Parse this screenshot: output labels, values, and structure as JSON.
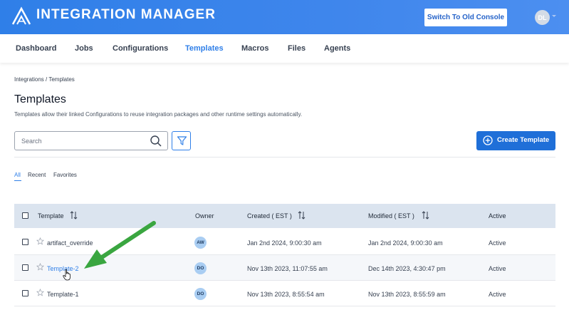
{
  "header": {
    "app_title": "INTEGRATION MANAGER",
    "switch_button": "Switch To Old Console",
    "user_initials": "DL",
    "brand_color": "#2f7fe8"
  },
  "nav": {
    "items": [
      {
        "label": "Dashboard",
        "active": false
      },
      {
        "label": "Jobs",
        "active": false
      },
      {
        "label": "Configurations",
        "active": false
      },
      {
        "label": "Templates",
        "active": true
      },
      {
        "label": "Macros",
        "active": false
      },
      {
        "label": "Files",
        "active": false
      },
      {
        "label": "Agents",
        "active": false
      }
    ]
  },
  "breadcrumb": "Integrations / Templates",
  "page": {
    "title": "Templates",
    "description": "Templates allow their linked Configurations to reuse integration packages and other runtime settings automatically."
  },
  "search": {
    "placeholder": "Search",
    "value": ""
  },
  "create_button": "Create Template",
  "tabs": [
    {
      "label": "All",
      "active": true
    },
    {
      "label": "Recent",
      "active": false
    },
    {
      "label": "Favorites",
      "active": false
    }
  ],
  "table": {
    "columns": [
      "Template",
      "Owner",
      "Created ( EST )",
      "Modified ( EST )",
      "Active"
    ],
    "rows": [
      {
        "name": "artifact_override",
        "owner": "AW",
        "created": "Jan 2nd 2024, 9:00:30 am",
        "modified": "Jan 2nd 2024, 9:00:30 am",
        "active": "Active"
      },
      {
        "name": "Template-2",
        "owner": "DO",
        "created": "Nov 13th 2023, 11:07:55 am",
        "modified": "Dec 14th 2023, 4:30:47 pm",
        "active": "Active"
      },
      {
        "name": "Template-1",
        "owner": "DO",
        "created": "Nov 13th 2023, 8:55:54 am",
        "modified": "Nov 13th 2023, 8:55:59 am",
        "active": "Active"
      }
    ]
  },
  "icons": {
    "logo": "mountain-logo-icon",
    "search": "search-icon",
    "filter": "filter-icon",
    "create": "plus-circle-icon",
    "sort": "sort-icon",
    "favorite": "star-icon",
    "annotation": "green-arrow-icon",
    "cursor": "hand-cursor-icon"
  }
}
